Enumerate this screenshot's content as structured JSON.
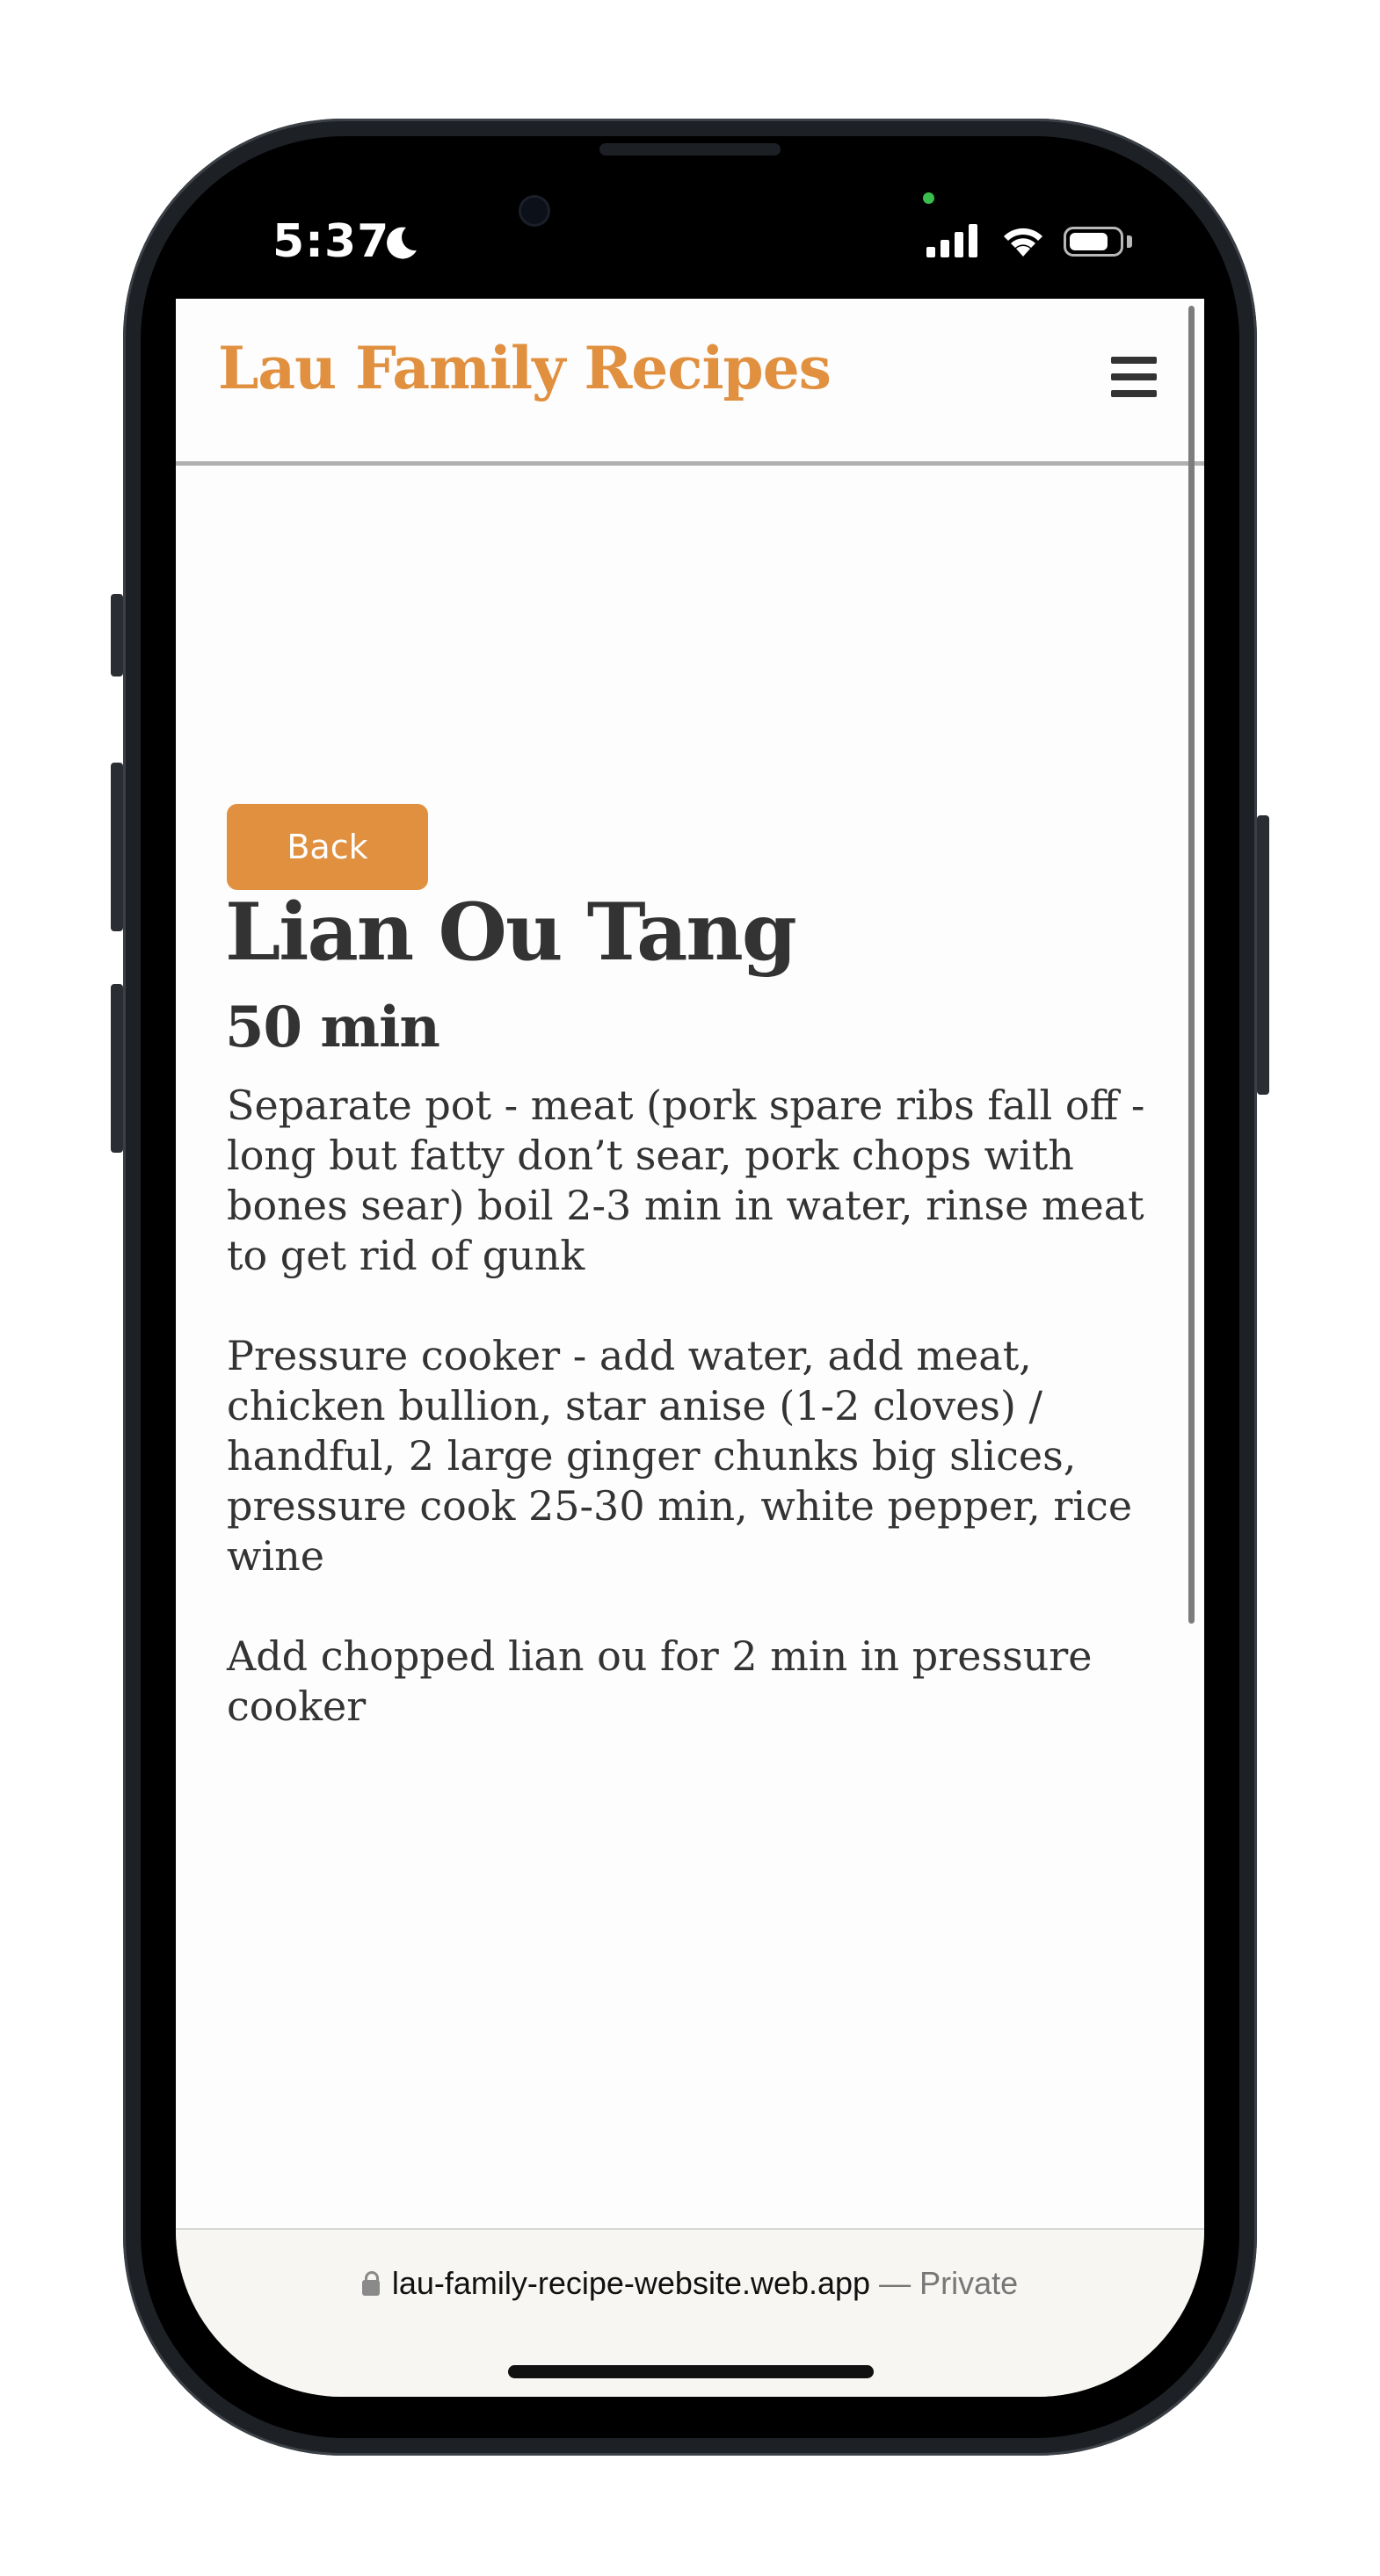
{
  "status_bar": {
    "time": "5:37",
    "focus_icon": "moon-icon",
    "signal_icon": "cellular-signal-icon",
    "wifi_icon": "wifi-icon",
    "battery_icon": "battery-icon",
    "battery_level": 0.8
  },
  "site": {
    "brand": "Lau Family Recipes",
    "menu_icon": "hamburger-menu-icon",
    "accent_color": "#e0903f"
  },
  "recipe": {
    "back_label": "Back",
    "title": "Lian Ou Tang",
    "time": "50 min",
    "paragraphs": [
      "Separate pot - meat (pork spare ribs fall off - long but fatty don’t sear, pork chops with bones sear) boil 2-3 min in water, rinse meat to get rid of gunk",
      "Pressure cooker - add water, add meat, chicken bullion, star anise (1-2 cloves) / handful, 2 large ginger chunks big slices, pressure cook 25-30 min, white pepper, rice wine",
      "Add chopped lian ou for 2 min in pressure cooker"
    ]
  },
  "browser": {
    "lock_icon": "lock-icon",
    "url": "lau-family-recipe-website.web.app",
    "mode": "— Private"
  }
}
